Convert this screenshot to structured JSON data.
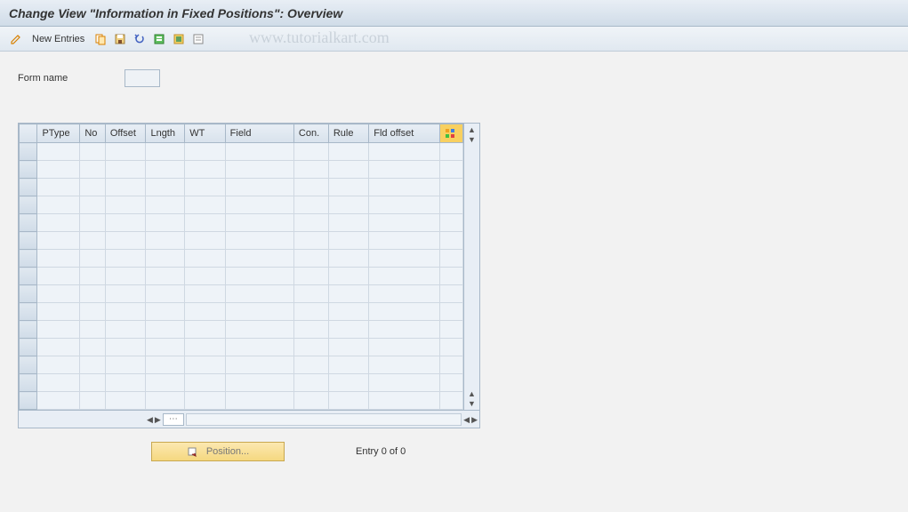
{
  "title": "Change View \"Information in Fixed Positions\": Overview",
  "watermark": "www.tutorialkart.com",
  "toolbar": {
    "new_entries_label": "New Entries"
  },
  "form": {
    "name_label": "Form name",
    "name_value": ""
  },
  "table": {
    "columns": [
      "PType",
      "No",
      "Offset",
      "Lngth",
      "WT",
      "Field",
      "Con.",
      "Rule",
      "Fld offset"
    ],
    "row_count": 15
  },
  "footer": {
    "position_label": "Position...",
    "entry_status": "Entry 0 of 0"
  }
}
